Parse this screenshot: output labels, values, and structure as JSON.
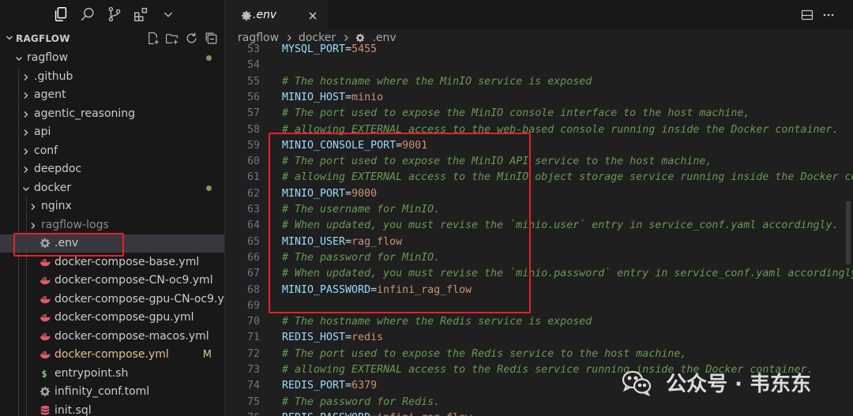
{
  "activity_bar": {
    "icons": [
      "files-icon",
      "search-icon",
      "source-control-icon",
      "extensions-icon",
      "chevron-down-icon"
    ]
  },
  "explorer": {
    "section_title": "RAGFLOW",
    "header_actions": [
      "new-file-icon",
      "new-folder-icon",
      "refresh-icon",
      "collapse-all-icon"
    ],
    "tree": [
      {
        "label": "ragflow",
        "kind": "folder-open",
        "indent": 0,
        "dot": true
      },
      {
        "label": ".github",
        "kind": "folder",
        "indent": 1
      },
      {
        "label": "agent",
        "kind": "folder",
        "indent": 1
      },
      {
        "label": "agentic_reasoning",
        "kind": "folder",
        "indent": 1
      },
      {
        "label": "api",
        "kind": "folder",
        "indent": 1
      },
      {
        "label": "conf",
        "kind": "folder",
        "indent": 1
      },
      {
        "label": "deepdoc",
        "kind": "folder",
        "indent": 1
      },
      {
        "label": "docker",
        "kind": "folder-open",
        "indent": 1,
        "dot": true
      },
      {
        "label": "nginx",
        "kind": "folder",
        "indent": 2
      },
      {
        "label": "ragflow-logs",
        "kind": "folder",
        "indent": 2,
        "dim": true
      },
      {
        "label": ".env",
        "kind": "gear",
        "indent": 2,
        "selected": true
      },
      {
        "label": "docker-compose-base.yml",
        "kind": "docker",
        "indent": 2
      },
      {
        "label": "docker-compose-CN-oc9.yml",
        "kind": "docker",
        "indent": 2
      },
      {
        "label": "docker-compose-gpu-CN-oc9.yml",
        "kind": "docker",
        "indent": 2
      },
      {
        "label": "docker-compose-gpu.yml",
        "kind": "docker",
        "indent": 2
      },
      {
        "label": "docker-compose-macos.yml",
        "kind": "docker",
        "indent": 2
      },
      {
        "label": "docker-compose.yml",
        "kind": "docker",
        "indent": 2,
        "modified": true,
        "badge": "M"
      },
      {
        "label": "entrypoint.sh",
        "kind": "shell",
        "indent": 2
      },
      {
        "label": "infinity_conf.toml",
        "kind": "gear",
        "indent": 2
      },
      {
        "label": "init.sql",
        "kind": "db",
        "indent": 2
      }
    ]
  },
  "editor": {
    "tab_label": ".env",
    "breadcrumb": [
      "ragflow",
      "docker",
      ".env"
    ],
    "lines": [
      {
        "n": "53",
        "type": "kv",
        "key": "MYSQL_PORT",
        "value": "5455"
      },
      {
        "n": "54",
        "type": "blank"
      },
      {
        "n": "55",
        "type": "comment",
        "text": "# The hostname where the MinIO service is exposed"
      },
      {
        "n": "56",
        "type": "kv",
        "key": "MINIO_HOST",
        "value": "minio"
      },
      {
        "n": "57",
        "type": "comment",
        "text": "# The port used to expose the MinIO console interface to the host machine,"
      },
      {
        "n": "58",
        "type": "comment",
        "text": "# allowing EXTERNAL access to the web-based console running inside the Docker container."
      },
      {
        "n": "59",
        "type": "kv",
        "key": "MINIO_CONSOLE_PORT",
        "value": "9001"
      },
      {
        "n": "60",
        "type": "comment",
        "text": "# The port used to expose the MinIO API service to the host machine,"
      },
      {
        "n": "61",
        "type": "comment",
        "text": "# allowing EXTERNAL access to the MinIO object storage service running inside the Docker container."
      },
      {
        "n": "62",
        "type": "kv",
        "key": "MINIO_PORT",
        "value": "9000"
      },
      {
        "n": "63",
        "type": "comment",
        "text": "# The username for MinIO."
      },
      {
        "n": "64",
        "type": "comment",
        "text": "# When updated, you must revise the `minio.user` entry in service_conf.yaml accordingly."
      },
      {
        "n": "65",
        "type": "kv",
        "key": "MINIO_USER",
        "value": "rag_flow"
      },
      {
        "n": "66",
        "type": "comment",
        "text": "# The password for MinIO."
      },
      {
        "n": "67",
        "type": "comment",
        "text": "# When updated, you must revise the `minio.password` entry in service_conf.yaml accordingly."
      },
      {
        "n": "68",
        "type": "kv",
        "key": "MINIO_PASSWORD",
        "value": "infini_rag_flow"
      },
      {
        "n": "69",
        "type": "blank"
      },
      {
        "n": "70",
        "type": "comment",
        "text": "# The hostname where the Redis service is exposed"
      },
      {
        "n": "71",
        "type": "kv",
        "key": "REDIS_HOST",
        "value": "redis"
      },
      {
        "n": "72",
        "type": "comment",
        "text": "# The port used to expose the Redis service to the host machine,"
      },
      {
        "n": "73",
        "type": "comment",
        "text": "# allowing EXTERNAL access to the Redis service running inside the Docker container."
      },
      {
        "n": "74",
        "type": "kv",
        "key": "REDIS_PORT",
        "value": "6379"
      },
      {
        "n": "75",
        "type": "comment",
        "text": "# The password for Redis."
      },
      {
        "n": "76",
        "type": "kv",
        "key": "REDIS_PASSWORD",
        "value": "infini_rag_flow"
      }
    ]
  },
  "annotations": {
    "highlight_color": "#e8202a"
  },
  "watermark": {
    "text": "公众号 · 韦东东"
  },
  "colors": {
    "background": "#1f1f1f",
    "sidebar": "#181818",
    "selection": "#37373d",
    "env_key": "#9cdcfe",
    "env_value": "#ce9178",
    "comment": "#6a9955",
    "modified": "#e2c08d"
  }
}
